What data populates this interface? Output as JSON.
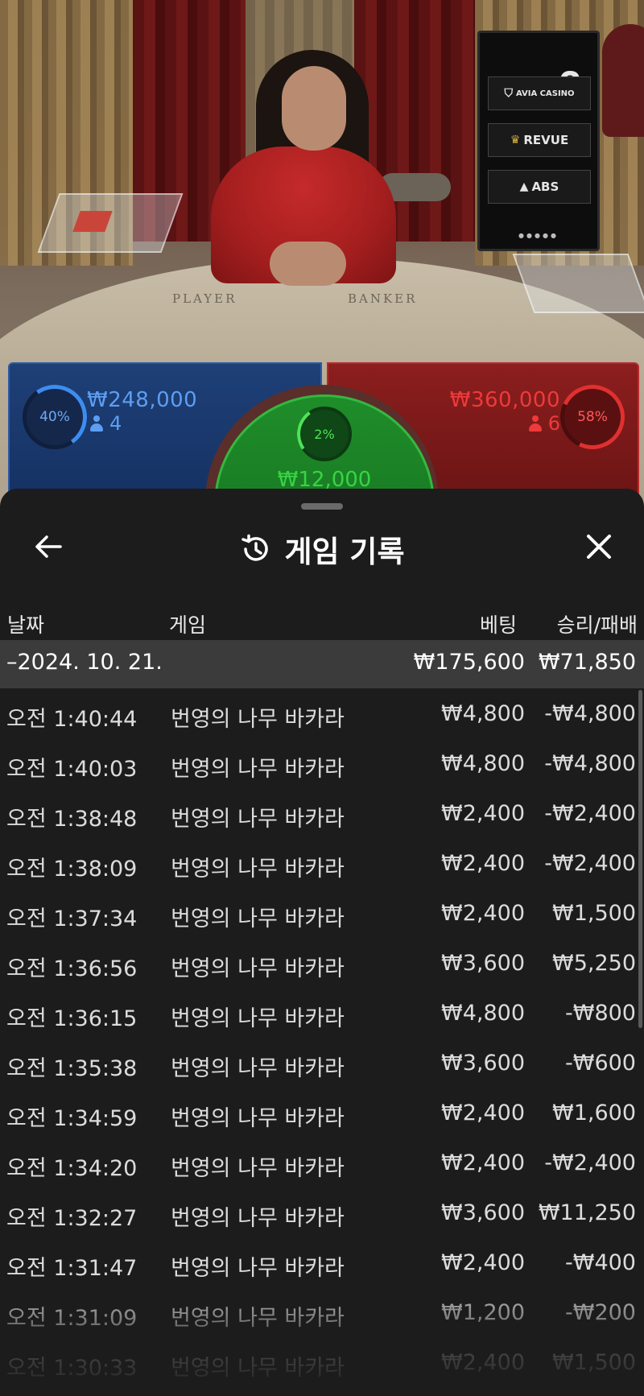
{
  "video": {
    "felt_player": "PLAYER",
    "felt_banker": "BANKER",
    "round_number": "2",
    "sponsors": [
      "AVIA CASINO",
      "REVUE",
      "ABS"
    ]
  },
  "bets": {
    "player": {
      "percent": "40%",
      "amount": "₩248,000",
      "count": "4"
    },
    "tie": {
      "percent": "2%",
      "amount": "₩12,000"
    },
    "banker": {
      "percent": "58%",
      "amount": "₩360,000",
      "count": "6"
    }
  },
  "sheet": {
    "title": "게임 기록",
    "columns": {
      "date": "날짜",
      "game": "게임",
      "bet": "베팅",
      "result": "승리/패배"
    },
    "group": {
      "date": "–2024. 10. 21.",
      "bet": "₩175,600",
      "result": "₩71,850"
    },
    "rows": [
      {
        "time": "오전 1:40:44",
        "game": "번영의 나무 바카라",
        "bet": "₩4,800",
        "result": "-₩4,800"
      },
      {
        "time": "오전 1:40:03",
        "game": "번영의 나무 바카라",
        "bet": "₩4,800",
        "result": "-₩4,800"
      },
      {
        "time": "오전 1:38:48",
        "game": "번영의 나무 바카라",
        "bet": "₩2,400",
        "result": "-₩2,400"
      },
      {
        "time": "오전 1:38:09",
        "game": "번영의 나무 바카라",
        "bet": "₩2,400",
        "result": "-₩2,400"
      },
      {
        "time": "오전 1:37:34",
        "game": "번영의 나무 바카라",
        "bet": "₩2,400",
        "result": "₩1,500"
      },
      {
        "time": "오전 1:36:56",
        "game": "번영의 나무 바카라",
        "bet": "₩3,600",
        "result": "₩5,250"
      },
      {
        "time": "오전 1:36:15",
        "game": "번영의 나무 바카라",
        "bet": "₩4,800",
        "result": "-₩800"
      },
      {
        "time": "오전 1:35:38",
        "game": "번영의 나무 바카라",
        "bet": "₩3,600",
        "result": "-₩600"
      },
      {
        "time": "오전 1:34:59",
        "game": "번영의 나무 바카라",
        "bet": "₩2,400",
        "result": "₩1,600"
      },
      {
        "time": "오전 1:34:20",
        "game": "번영의 나무 바카라",
        "bet": "₩2,400",
        "result": "-₩2,400"
      },
      {
        "time": "오전 1:32:27",
        "game": "번영의 나무 바카라",
        "bet": "₩3,600",
        "result": "₩11,250"
      },
      {
        "time": "오전 1:31:47",
        "game": "번영의 나무 바카라",
        "bet": "₩2,400",
        "result": "-₩400"
      },
      {
        "time": "오전 1:31:09",
        "game": "번영의 나무 바카라",
        "bet": "₩1,200",
        "result": "-₩200"
      },
      {
        "time": "오전 1:30:33",
        "game": "번영의 나무 바카라",
        "bet": "₩2,400",
        "result": "₩1,500"
      }
    ]
  },
  "colors": {
    "player": "#5d9ef2",
    "banker": "#ee3a3a",
    "tie": "#37d444",
    "sheet_bg": "#1c1c1c",
    "group_bg": "#3b3b3b"
  },
  "icons": {
    "back": "arrow-left-icon",
    "history": "history-icon",
    "close": "close-icon",
    "players": "person-icon"
  }
}
